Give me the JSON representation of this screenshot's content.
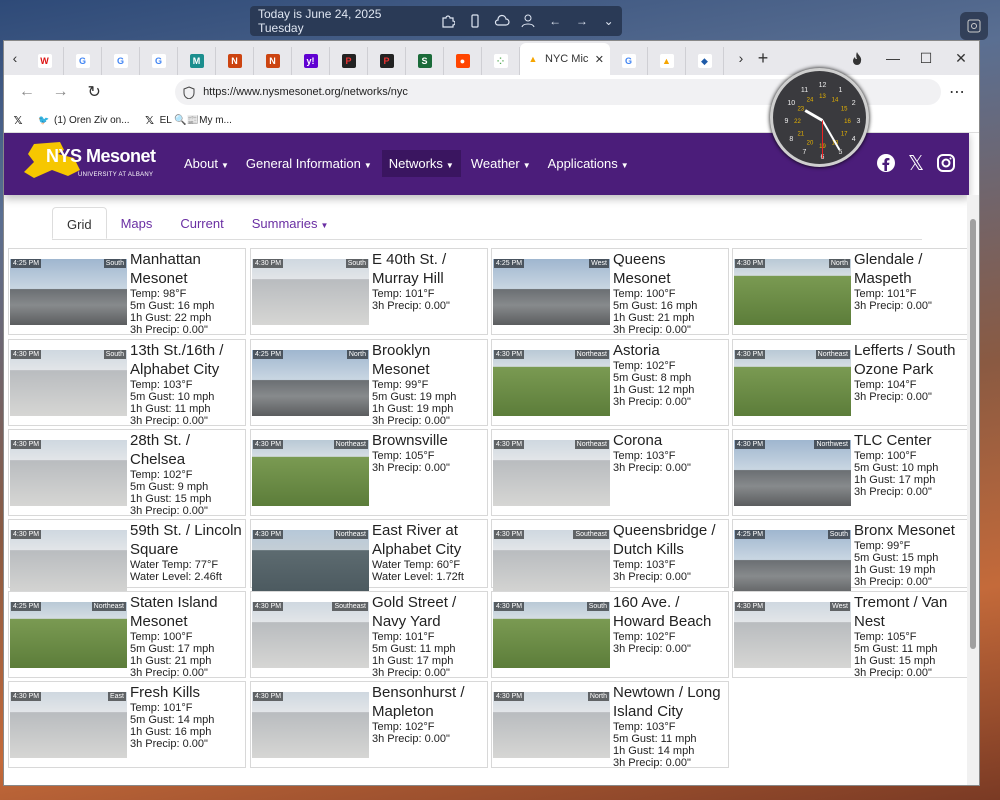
{
  "desktop": {
    "date_text": "Today is June 24, 2025 Tuesday"
  },
  "browser": {
    "tabs": [
      {
        "icon": "wolfram-icon",
        "label": ""
      },
      {
        "icon": "google-icon",
        "label": ""
      },
      {
        "icon": "google-icon",
        "label": ""
      },
      {
        "icon": "google-icon",
        "label": ""
      },
      {
        "icon": "m-icon",
        "label": ""
      },
      {
        "icon": "red-news-icon",
        "label": ""
      },
      {
        "icon": "red-news-icon",
        "label": ""
      },
      {
        "icon": "yahoo-icon",
        "label": ""
      },
      {
        "icon": "dark-red-icon",
        "label": ""
      },
      {
        "icon": "dark-red-icon",
        "label": ""
      },
      {
        "icon": "green-s-icon",
        "label": ""
      },
      {
        "icon": "reddit-icon",
        "label": ""
      },
      {
        "icon": "chart-dots-icon",
        "label": ""
      }
    ],
    "active_tab": {
      "label": "NYC Mic",
      "icon": "nysm-icon"
    },
    "extra_tabs": [
      {
        "icon": "google-icon"
      },
      {
        "icon": "nysm-icon"
      },
      {
        "icon": "shield-icon"
      }
    ],
    "url": "https://www.nysmesonet.org/networks/nyc",
    "bookmarks": [
      {
        "icon": "x-icon",
        "label": ""
      },
      {
        "icon": "twitter-icon",
        "label": "(1) Oren Ziv on..."
      },
      {
        "icon": "x-icon",
        "label": "EL 🔍📰My m..."
      }
    ]
  },
  "site": {
    "logo_text": "NYS Mesonet",
    "logo_sub": "UNIVERSITY AT ALBANY",
    "menu": [
      {
        "label": "About",
        "dropdown": true
      },
      {
        "label": "General Information",
        "dropdown": true
      },
      {
        "label": "Networks",
        "dropdown": true,
        "active": true
      },
      {
        "label": "Weather",
        "dropdown": true
      },
      {
        "label": "Applications",
        "dropdown": true
      }
    ],
    "subtabs": [
      {
        "label": "Grid",
        "active": true
      },
      {
        "label": "Maps"
      },
      {
        "label": "Current"
      },
      {
        "label": "Summaries",
        "dropdown": true
      }
    ]
  },
  "stations": [
    {
      "name": "Manhattan Mesonet",
      "time": "4:25 PM",
      "dir": "South",
      "lines": [
        "Temp: 98°F",
        "5m Gust: 16 mph",
        "1h Gust: 22 mph",
        "3h Precip: 0.00\""
      ],
      "scene": "city"
    },
    {
      "name": "E 40th St. / Murray Hill",
      "time": "4:30 PM",
      "dir": "South",
      "lines": [
        "Temp: 101°F",
        "3h Precip: 0.00\""
      ],
      "scene": "roof"
    },
    {
      "name": "Queens Mesonet",
      "time": "4:25 PM",
      "dir": "West",
      "lines": [
        "Temp: 100°F",
        "5m Gust: 16 mph",
        "1h Gust: 21 mph",
        "3h Precip: 0.00\""
      ],
      "scene": "city"
    },
    {
      "name": "Glendale / Maspeth",
      "time": "4:30 PM",
      "dir": "North",
      "lines": [
        "Temp: 101°F",
        "3h Precip: 0.00\""
      ],
      "scene": "grass"
    },
    {
      "name": "13th St./16th / Alphabet City",
      "time": "4:30 PM",
      "dir": "South",
      "lines": [
        "Temp: 103°F",
        "5m Gust: 10 mph",
        "1h Gust: 11 mph",
        "3h Precip: 0.00\""
      ],
      "scene": "roof"
    },
    {
      "name": "Brooklyn Mesonet",
      "time": "4:25 PM",
      "dir": "North",
      "lines": [
        "Temp: 99°F",
        "5m Gust: 19 mph",
        "1h Gust: 19 mph",
        "3h Precip: 0.00\""
      ],
      "scene": "city"
    },
    {
      "name": "Astoria",
      "time": "4:30 PM",
      "dir": "Northeast",
      "lines": [
        "Temp: 102°F",
        "5m Gust: 8 mph",
        "1h Gust: 12 mph",
        "3h Precip: 0.00\""
      ],
      "scene": "grass"
    },
    {
      "name": "Lefferts / South Ozone Park",
      "time": "4:30 PM",
      "dir": "Northeast",
      "lines": [
        "Temp: 104°F",
        "3h Precip: 0.00\""
      ],
      "scene": "grass"
    },
    {
      "name": "28th St. / Chelsea",
      "time": "4:30 PM",
      "dir": "",
      "lines": [
        "Temp: 102°F",
        "5m Gust: 9 mph",
        "1h Gust: 15 mph",
        "3h Precip: 0.00\""
      ],
      "scene": "roof"
    },
    {
      "name": "Brownsville",
      "time": "4:30 PM",
      "dir": "Northeast",
      "lines": [
        "Temp: 105°F",
        "3h Precip: 0.00\""
      ],
      "scene": "grass"
    },
    {
      "name": "Corona",
      "time": "4:30 PM",
      "dir": "Northeast",
      "lines": [
        "Temp: 103°F",
        "3h Precip: 0.00\""
      ],
      "scene": "roof"
    },
    {
      "name": "TLC Center",
      "time": "4:30 PM",
      "dir": "Northwest",
      "lines": [
        "Temp: 100°F",
        "5m Gust: 10 mph",
        "1h Gust: 17 mph",
        "3h Precip: 0.00\""
      ],
      "scene": "city"
    },
    {
      "name": "59th St. / Lincoln Square",
      "time": "4:30 PM",
      "dir": "",
      "lines": [
        "Water Temp: 77°F",
        "Water Level: 2.46ft"
      ],
      "scene": "roof"
    },
    {
      "name": "East River at Alphabet City",
      "time": "4:30 PM",
      "dir": "Northeast",
      "lines": [
        "Water Temp: 60°F",
        "Water Level: 1.72ft"
      ],
      "scene": "water"
    },
    {
      "name": "Queensbridge / Dutch Kills",
      "time": "4:30 PM",
      "dir": "Southeast",
      "lines": [
        "Temp: 103°F",
        "3h Precip: 0.00\""
      ],
      "scene": "roof"
    },
    {
      "name": "Bronx Mesonet",
      "time": "4:25 PM",
      "dir": "South",
      "lines": [
        "Temp: 99°F",
        "5m Gust: 15 mph",
        "1h Gust: 19 mph",
        "3h Precip: 0.00\""
      ],
      "scene": "city"
    },
    {
      "name": "Staten Island Mesonet",
      "time": "4:25 PM",
      "dir": "Northeast",
      "lines": [
        "Temp: 100°F",
        "5m Gust: 17 mph",
        "1h Gust: 21 mph",
        "3h Precip: 0.00\""
      ],
      "scene": "grass"
    },
    {
      "name": "Gold Street / Navy Yard",
      "time": "4:30 PM",
      "dir": "Southeast",
      "lines": [
        "Temp: 101°F",
        "5m Gust: 11 mph",
        "1h Gust: 17 mph",
        "3h Precip: 0.00\""
      ],
      "scene": "roof"
    },
    {
      "name": "160 Ave. / Howard Beach",
      "time": "4:30 PM",
      "dir": "South",
      "lines": [
        "Temp: 102°F",
        "3h Precip: 0.00\""
      ],
      "scene": "grass"
    },
    {
      "name": "Tremont / Van Nest",
      "time": "4:30 PM",
      "dir": "West",
      "lines": [
        "Temp: 105°F",
        "5m Gust: 11 mph",
        "1h Gust: 15 mph",
        "3h Precip: 0.00\""
      ],
      "scene": "roof"
    },
    {
      "name": "Fresh Kills",
      "time": "4:30 PM",
      "dir": "East",
      "lines": [
        "Temp: 101°F",
        "5m Gust: 14 mph",
        "1h Gust: 16 mph",
        "3h Precip: 0.00\""
      ],
      "scene": "roof"
    },
    {
      "name": "Bensonhurst / Mapleton",
      "time": "4:30 PM",
      "dir": "",
      "lines": [
        "Temp: 102°F",
        "3h Precip: 0.00\""
      ],
      "scene": "roof"
    },
    {
      "name": "Newtown / Long Island City",
      "time": "4:30 PM",
      "dir": "North",
      "lines": [
        "Temp: 103°F",
        "5m Gust: 11 mph",
        "1h Gust: 14 mph",
        "3h Precip: 0.00\""
      ],
      "scene": "roof"
    }
  ],
  "clock": {
    "numbers": [
      "12",
      "1",
      "2",
      "3",
      "4",
      "5",
      "6",
      "7",
      "8",
      "9",
      "10",
      "11",
      "13",
      "14",
      "15",
      "16",
      "17",
      "18",
      "19",
      "20",
      "21",
      "22",
      "23",
      "24"
    ]
  },
  "colors": {
    "nav": "#4b1d7a",
    "accent": "#6a2fa3",
    "logo_gold": "#f6c700"
  }
}
